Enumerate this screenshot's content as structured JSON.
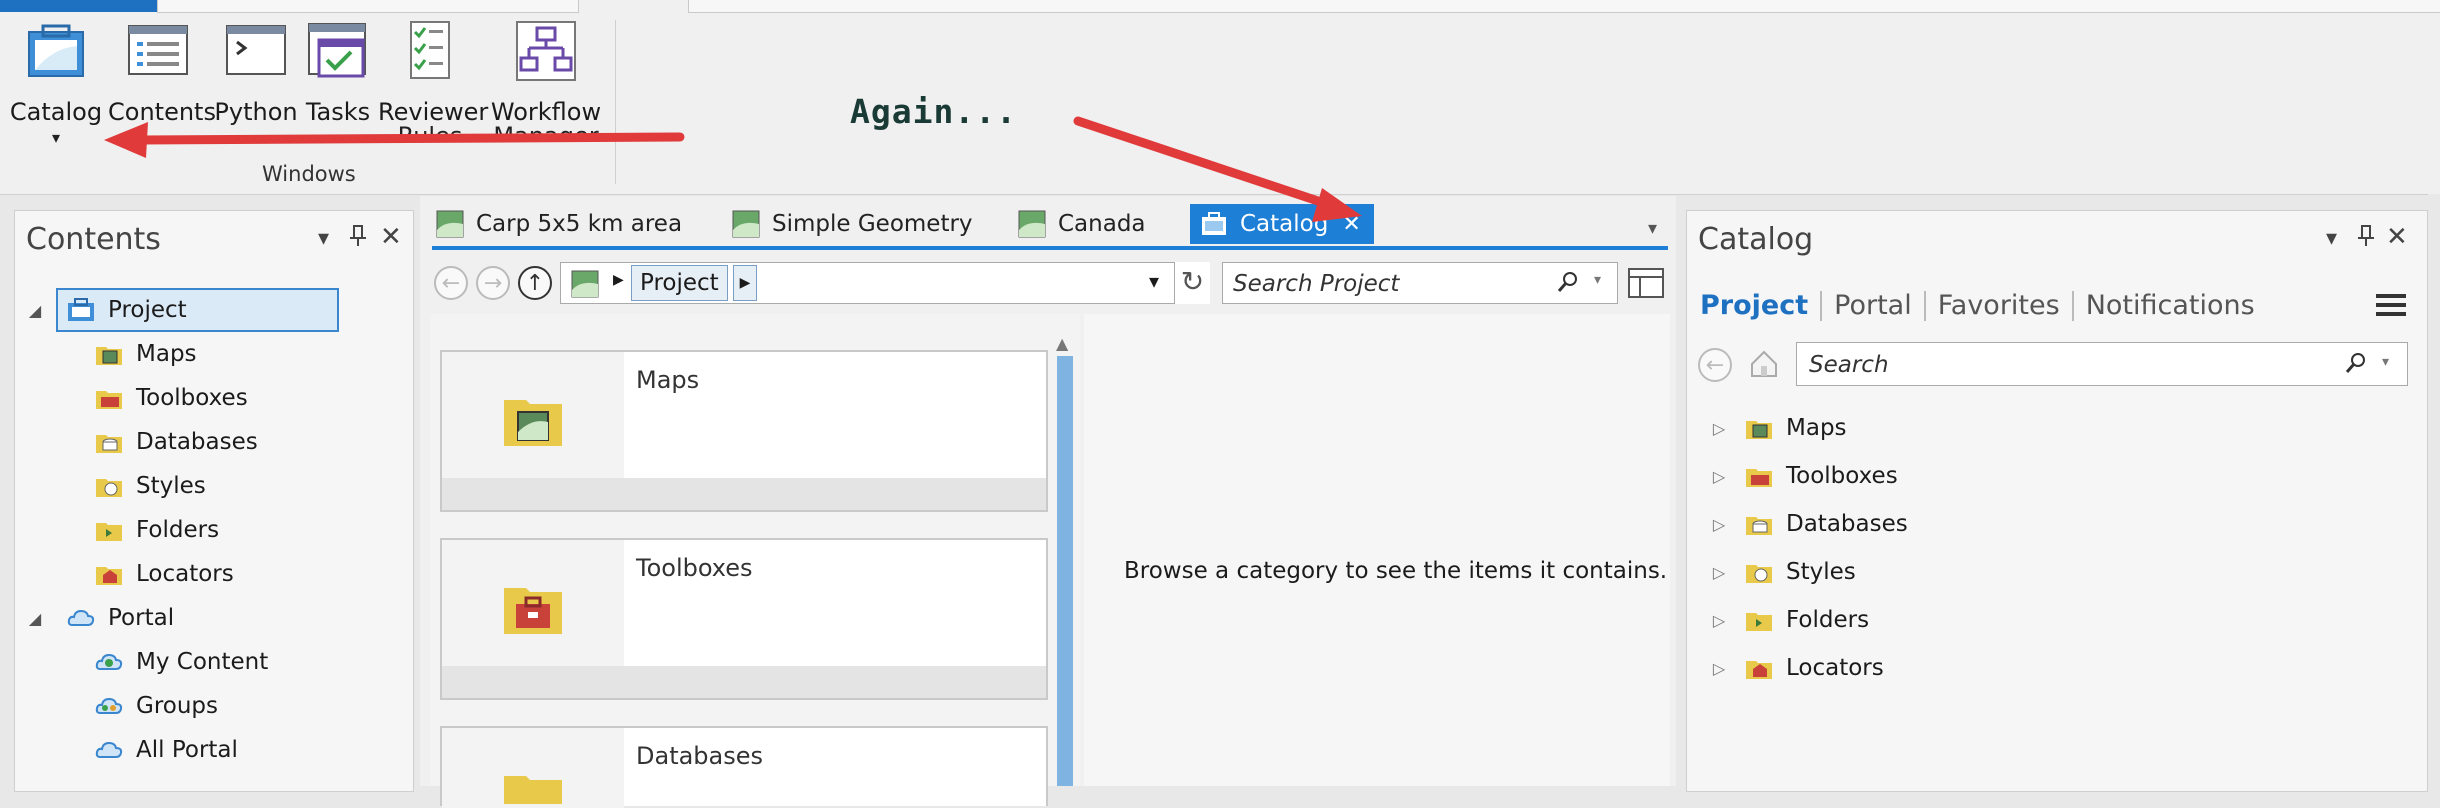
{
  "ribbon": {
    "buttons": [
      {
        "label": "Catalog",
        "label2": "▾"
      },
      {
        "label": "Contents",
        "label2": ""
      },
      {
        "label": "Python",
        "label2": ""
      },
      {
        "label": "Tasks",
        "label2": ""
      },
      {
        "label": "Reviewer",
        "label2": "Rules"
      },
      {
        "label": "Workflow",
        "label2": "Manager"
      }
    ],
    "group_label": "Windows",
    "annotation": "Again..."
  },
  "contents_pane": {
    "title": "Contents",
    "tree": [
      {
        "label": "Project",
        "level": 0,
        "expanded": true,
        "selected": true
      },
      {
        "label": "Maps",
        "level": 1
      },
      {
        "label": "Toolboxes",
        "level": 1
      },
      {
        "label": "Databases",
        "level": 1
      },
      {
        "label": "Styles",
        "level": 1
      },
      {
        "label": "Folders",
        "level": 1
      },
      {
        "label": "Locators",
        "level": 1
      },
      {
        "label": "Portal",
        "level": 0,
        "expanded": true
      },
      {
        "label": "My Content",
        "level": 1
      },
      {
        "label": "Groups",
        "level": 1
      },
      {
        "label": "All Portal",
        "level": 1
      }
    ]
  },
  "doc_tabs": [
    {
      "label": "Carp 5x5 km area"
    },
    {
      "label": "Simple Geometry"
    },
    {
      "label": "Canada"
    },
    {
      "label": "Catalog",
      "active": true
    }
  ],
  "catalog_view": {
    "breadcrumb": "Project",
    "search_placeholder": "Search Project",
    "cards": [
      {
        "label": "Maps"
      },
      {
        "label": "Toolboxes"
      },
      {
        "label": "Databases"
      }
    ],
    "empty_message": "Browse a category to see the items it contains."
  },
  "catalog_pane": {
    "title": "Catalog",
    "tabs": [
      "Project",
      "Portal",
      "Favorites",
      "Notifications"
    ],
    "search_placeholder": "Search",
    "items": [
      "Maps",
      "Toolboxes",
      "Databases",
      "Styles",
      "Folders",
      "Locators"
    ]
  },
  "colors": {
    "accent": "#1e7fd7",
    "arrow": "#e03a3a",
    "folder": "#e8c94a"
  }
}
